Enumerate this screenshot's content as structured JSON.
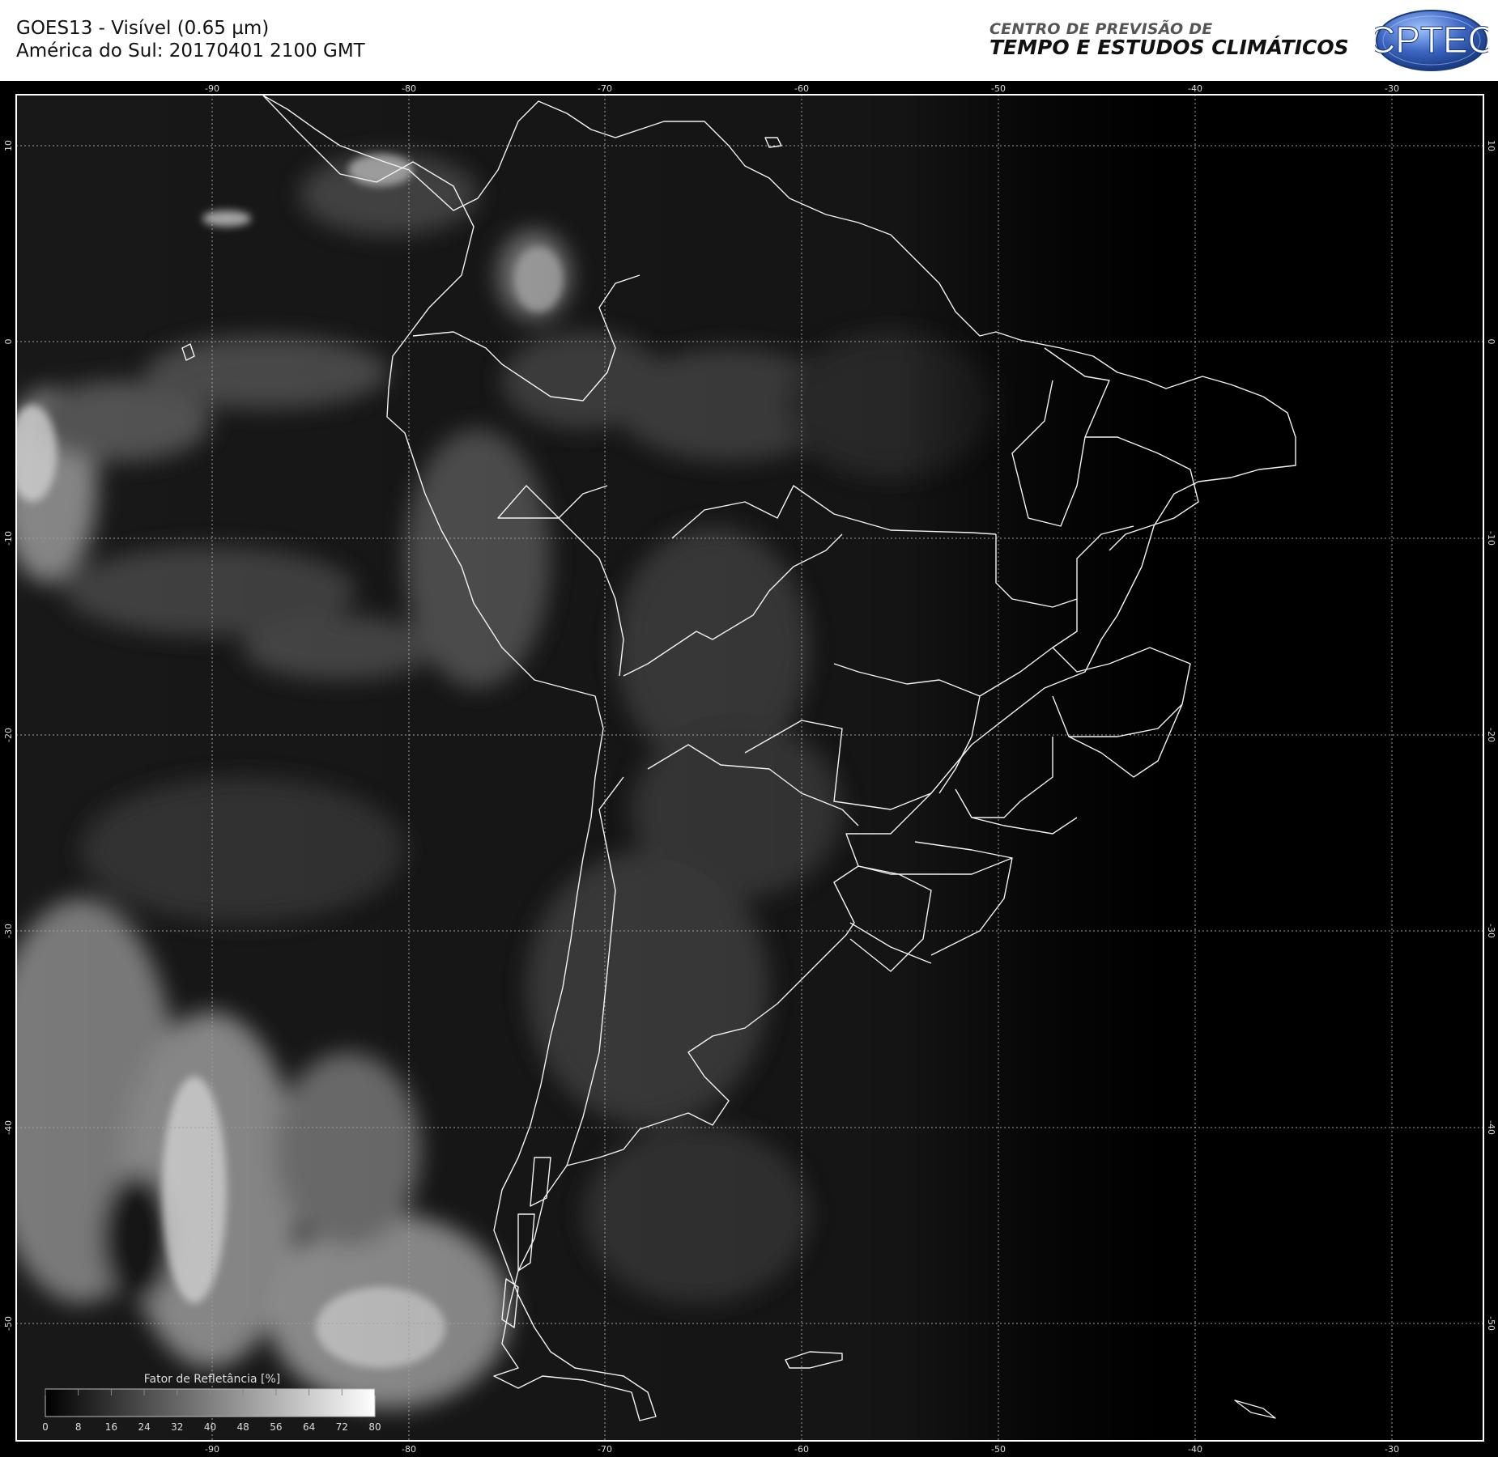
{
  "header": {
    "title_line1": "GOES13 - Visível (0.65 µm)",
    "title_line2": "América do Sul: 20170401 2100 GMT",
    "org_line1": "CENTRO DE PREVISÃO DE",
    "org_line2": "TEMPO E ESTUDOS CLIMÁTICOS",
    "logo_text": "CPTEC"
  },
  "map": {
    "longitudes": [
      "-90",
      "-80",
      "-70",
      "-60",
      "-50",
      "-40",
      "-30"
    ],
    "latitudes": [
      "10",
      "0",
      "-10",
      "-20",
      "-30",
      "-40",
      "-50"
    ]
  },
  "colorbar": {
    "title": "Fator de Refletância [%]",
    "ticks": [
      "0",
      "8",
      "16",
      "24",
      "32",
      "40",
      "48",
      "56",
      "64",
      "72",
      "80"
    ]
  },
  "colors": {
    "background": "#000000",
    "header_bg": "#ffffff",
    "frame": "#ffffff",
    "grid": "#a0a0a0",
    "logo_blue": "#2c4f9c"
  }
}
